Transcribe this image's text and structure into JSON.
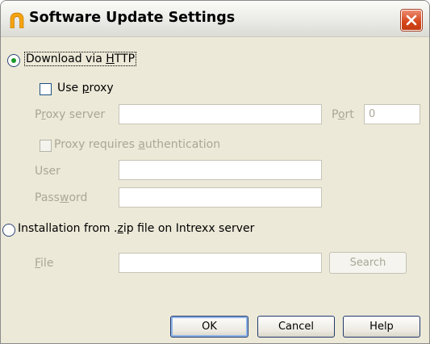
{
  "window": {
    "title": "Software Update Settings"
  },
  "download": {
    "label_pre": "Download via ",
    "label_key": "H",
    "label_post": "TTP",
    "selected": true
  },
  "proxy": {
    "use_proxy_pre": "Use ",
    "use_proxy_key": "p",
    "use_proxy_post": "roxy",
    "server_label_pre": "P",
    "server_label_key": "r",
    "server_label_post": "oxy server",
    "server_value": "",
    "port_label_pre": "P",
    "port_label_key": "o",
    "port_label_post": "rt",
    "port_value": "0",
    "auth_pre": "Proxy requires ",
    "auth_key": "a",
    "auth_post": "uthentication",
    "user_label": "User",
    "user_value": "",
    "password_label_pre": "Pass",
    "password_label_key": "w",
    "password_label_post": "ord",
    "password_value": ""
  },
  "install_zip": {
    "label_pre": "Installation from .",
    "label_key": "z",
    "label_post": "ip file on Intrexx server",
    "selected": false,
    "file_label_key": "F",
    "file_label_post": "ile",
    "file_value": "",
    "search_label": "Search"
  },
  "buttons": {
    "ok": "OK",
    "cancel": "Cancel",
    "help": "Help"
  },
  "icons": {
    "app": "intrexx-logo-icon",
    "close": "close-icon"
  },
  "colors": {
    "window_bg": "#ece9d8",
    "close_red": "#d54518",
    "radio_dot": "#1a9a2a",
    "disabled_text": "#a9a797"
  }
}
